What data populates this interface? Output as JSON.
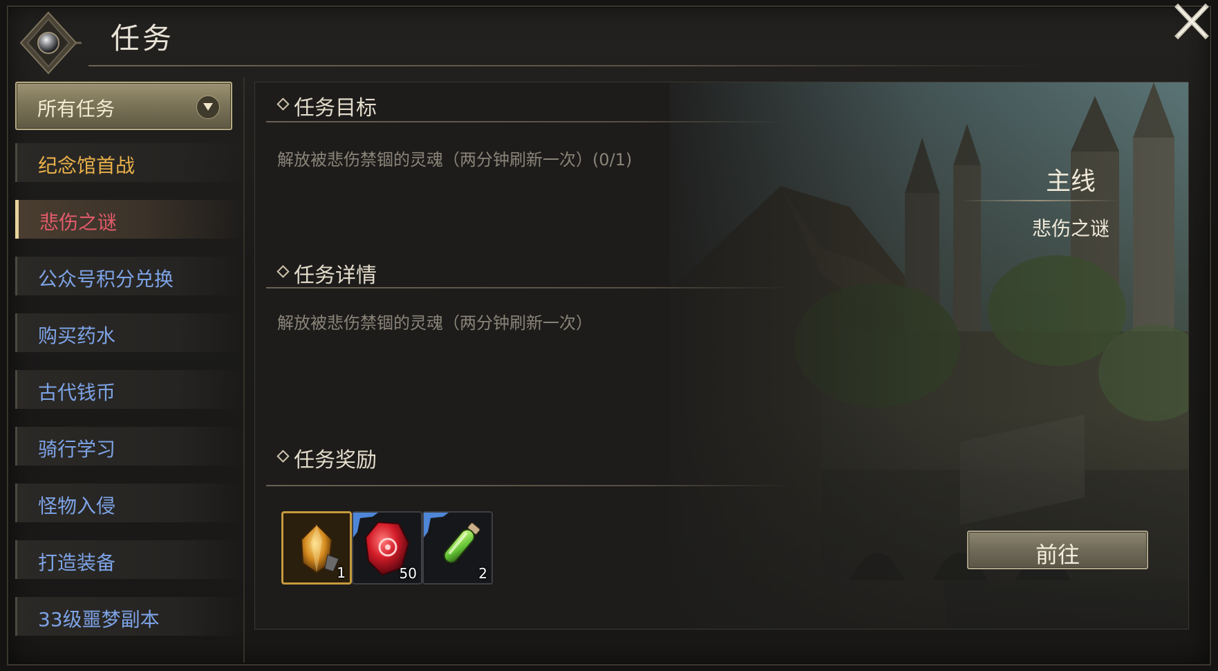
{
  "window": {
    "title": "任务"
  },
  "sidebar": {
    "filter": {
      "label": "所有任务"
    },
    "items": [
      {
        "label": "纪念馆首战",
        "state": "gold"
      },
      {
        "label": "悲伤之谜",
        "state": "active"
      },
      {
        "label": "公众号积分兑换",
        "state": "normal"
      },
      {
        "label": "购买药水",
        "state": "normal"
      },
      {
        "label": "古代钱币",
        "state": "normal"
      },
      {
        "label": "骑行学习",
        "state": "normal"
      },
      {
        "label": "怪物入侵",
        "state": "normal"
      },
      {
        "label": "打造装备",
        "state": "normal"
      },
      {
        "label": "33级噩梦副本",
        "state": "normal"
      }
    ]
  },
  "quest": {
    "objective": {
      "heading": "任务目标",
      "text": "解放被悲伤禁锢的灵魂（两分钟刷新一次）(0/1)"
    },
    "details": {
      "heading": "任务详情",
      "text": "解放被悲伤禁锢的灵魂（两分钟刷新一次）"
    },
    "rewards": {
      "heading": "任务奖励",
      "items": [
        {
          "icon": "amber-crystal-icon",
          "count": "1",
          "frame": "gold"
        },
        {
          "icon": "red-gem-icon",
          "count": "50",
          "frame": "blue"
        },
        {
          "icon": "green-potion-icon",
          "count": "2",
          "frame": "blue"
        }
      ]
    },
    "type": {
      "category": "主线",
      "name": "悲伤之谜"
    },
    "goto_button": "前往"
  },
  "colors": {
    "gold_text": "#e9b14a",
    "active_text": "#e25b6a",
    "normal_text": "#7da3e6"
  }
}
